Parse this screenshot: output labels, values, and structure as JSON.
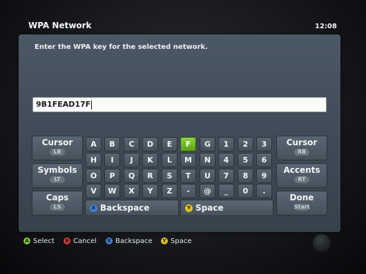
{
  "header": {
    "title": "WPA Network",
    "clock": "12:08"
  },
  "prompt": "Enter the WPA key for the selected network.",
  "keyfield": {
    "value": "9B1FEAD17F"
  },
  "side_keys": {
    "cursor_left": {
      "label": "Cursor",
      "sub": "LB"
    },
    "symbols": {
      "label": "Symbols",
      "sub": "LT"
    },
    "caps": {
      "label": "Caps",
      "sub": "LS"
    },
    "cursor_right": {
      "label": "Cursor",
      "sub": "RB"
    },
    "accents": {
      "label": "Accents",
      "sub": "RT"
    },
    "done": {
      "label": "Done",
      "sub": "Start"
    }
  },
  "keys": {
    "row1": [
      "A",
      "B",
      "C",
      "D",
      "E",
      "F",
      "G",
      "1",
      "2",
      "3"
    ],
    "row2": [
      "H",
      "I",
      "J",
      "K",
      "L",
      "M",
      "N",
      "4",
      "5",
      "6"
    ],
    "row3": [
      "O",
      "P",
      "Q",
      "R",
      "S",
      "T",
      "U",
      "7",
      "8",
      "9"
    ],
    "row4": [
      "V",
      "W",
      "X",
      "Y",
      "Z",
      "-",
      "@",
      "_",
      "0",
      "."
    ]
  },
  "active_key": "F",
  "backspace": {
    "label": "Backspace",
    "button": "X"
  },
  "space": {
    "label": "Space",
    "button": "Y"
  },
  "help_bar": [
    {
      "button": "A",
      "label": "Select",
      "color": "#7cc93a"
    },
    {
      "button": "B",
      "label": "Cancel",
      "color": "#d63a2e"
    },
    {
      "button": "X",
      "label": "Backspace",
      "color": "#3a82d6"
    },
    {
      "button": "Y",
      "label": "Space",
      "color": "#e2c21c"
    }
  ]
}
